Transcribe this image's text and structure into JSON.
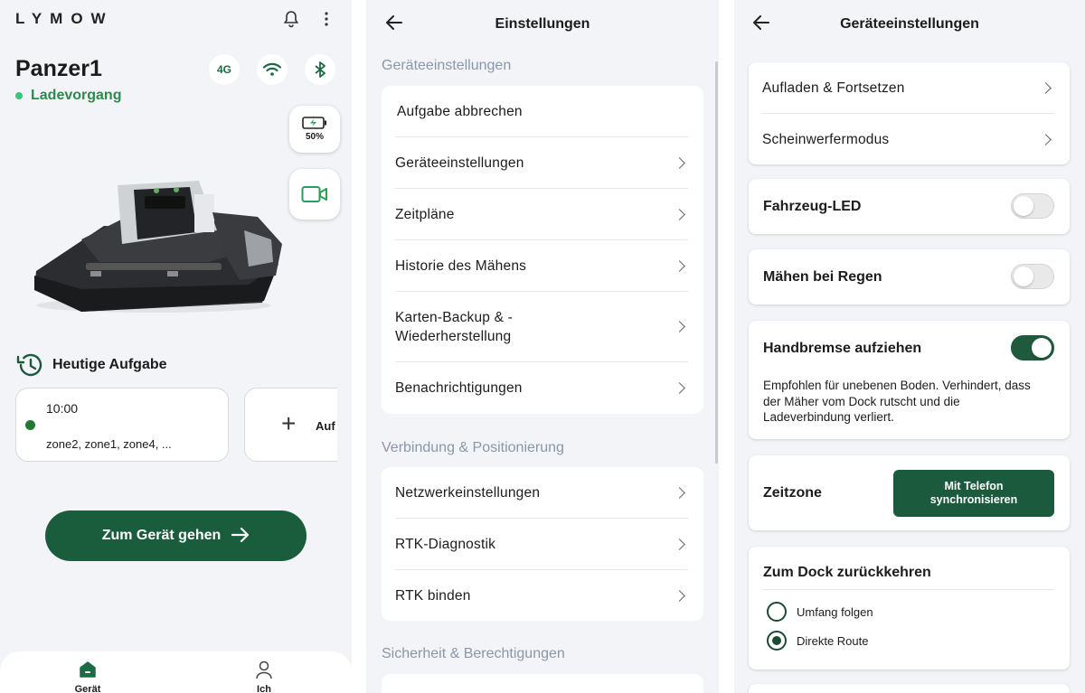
{
  "home": {
    "logo": "LYMOW",
    "device_name": "Panzer1",
    "status": "Ladevorgang",
    "chips": [
      "4G"
    ],
    "battery": "50%",
    "today_label": "Heutige Aufgabe",
    "task": {
      "time": "10:00",
      "zones": "zone2, zone1, zone4, ..."
    },
    "add_label": "Auf",
    "go_button": "Zum Gerät gehen",
    "nav": {
      "device": "Gerät",
      "me": "Ich"
    },
    "accent": "#1a5d3d"
  },
  "settings": {
    "title": "Einstellungen",
    "sections": [
      {
        "title": "Geräteeinstellungen",
        "items": [
          "Aufgabe abbrechen",
          "Geräteeinstellungen",
          "Zeitpläne",
          "Historie des Mähens",
          "Karten-Backup & -Wiederherstellung",
          "Benachrichtigungen"
        ]
      },
      {
        "title": "Verbindung & Positionierung",
        "items": [
          "Netzwerkeinstellungen",
          "RTK-Diagnostik",
          "RTK binden"
        ]
      },
      {
        "title": "Sicherheit & Berechtigungen",
        "items": []
      }
    ]
  },
  "device_settings": {
    "title": "Geräteeinstellungen",
    "nav_items": [
      "Aufladen & Fortsetzen",
      "Scheinwerfermodus"
    ],
    "vehicle_led": {
      "label": "Fahrzeug-LED",
      "on": false
    },
    "rain_mowing": {
      "label": "Mähen bei Regen",
      "on": false
    },
    "handbrake": {
      "label": "Handbremse aufziehen",
      "on": true,
      "description": "Empfohlen für unebenen Boden. Verhindert, dass der Mäher vom Dock rutscht und die Ladeverbindung verliert."
    },
    "timezone": {
      "label": "Zeitzone",
      "button_line1": "Mit Telefon",
      "button_line2": "synchronisieren"
    },
    "return_dock": {
      "label": "Zum Dock zurückkehren",
      "options": [
        "Umfang folgen",
        "Direkte Route"
      ],
      "selected": "Direkte Route"
    }
  }
}
